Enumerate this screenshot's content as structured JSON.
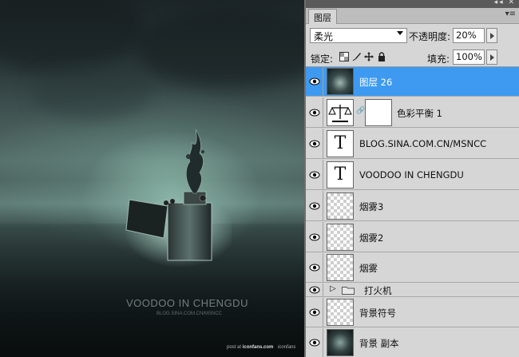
{
  "artwork": {
    "title": "VOODOO IN CHENGDU",
    "subtitle": "BLOG.SINA.COM.CN/MSNCC",
    "credit_prefix": "post at",
    "credit_site": "iconfans.com",
    "credit_logo": "iconfans"
  },
  "panel": {
    "tab_label": "图层",
    "collapse_icon": "double-chevron-icon",
    "menu_icon": "panel-menu-icon",
    "blend_mode": "柔光",
    "opacity_label": "不透明度:",
    "opacity_value": "20%",
    "lock_label": "锁定:",
    "fill_label": "填充:",
    "fill_value": "100%",
    "accent": "#3d9af0"
  },
  "layers": [
    {
      "name": "图层 26",
      "type": "image",
      "selected": true
    },
    {
      "name": "色彩平衡 1",
      "type": "adjustment"
    },
    {
      "name": "BLOG.SINA.COM.CN/MSNCC",
      "type": "text"
    },
    {
      "name": "VOODOO IN CHENGDU",
      "type": "text"
    },
    {
      "name": "烟雾3",
      "type": "empty"
    },
    {
      "name": "烟雾2",
      "type": "empty"
    },
    {
      "name": "烟雾",
      "type": "empty"
    },
    {
      "name": "打火机",
      "type": "group"
    },
    {
      "name": "背景符号",
      "type": "empty"
    },
    {
      "name": "背景 副本",
      "type": "image"
    }
  ]
}
